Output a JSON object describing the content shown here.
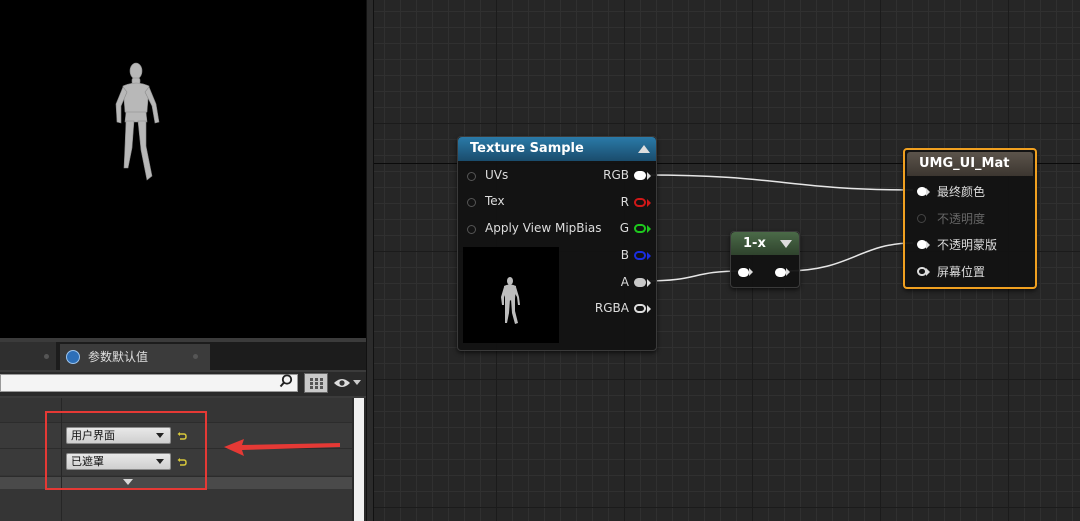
{
  "details_panel": {
    "tab_label": "参数默认值",
    "dropdowns": [
      {
        "value": "用户界面"
      },
      {
        "value": "已遮罩"
      }
    ]
  },
  "graph": {
    "texture_sample": {
      "title": "Texture Sample",
      "inputs": [
        "UVs",
        "Tex",
        "Apply View MipBias"
      ],
      "outputs": [
        "RGB",
        "R",
        "G",
        "B",
        "A",
        "RGBA"
      ]
    },
    "one_minus": {
      "title": "1-x"
    },
    "material_output": {
      "title": "UMG_UI_Mat",
      "inputs": [
        {
          "label": "最终颜色",
          "enabled": true
        },
        {
          "label": "不透明度",
          "enabled": false
        },
        {
          "label": "不透明蒙版",
          "enabled": true
        },
        {
          "label": "屏幕位置",
          "enabled": true
        }
      ]
    }
  },
  "colors": {
    "texture_title": "#1f5f85",
    "one_minus_title": "#3b5238",
    "material_title": "#4a433b",
    "material_border": "#f0a020",
    "annotation_red": "#e53935"
  }
}
